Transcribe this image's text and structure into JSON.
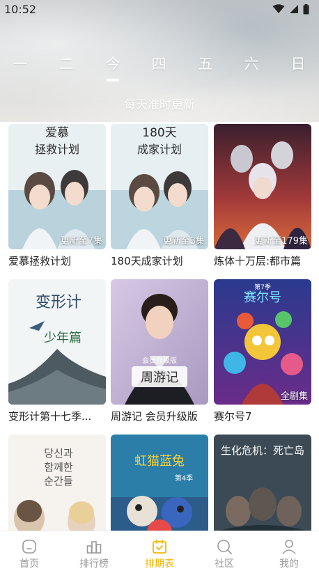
{
  "status_bar": {
    "time": "10:52"
  },
  "day_tabs": [
    "一",
    "二",
    "今",
    "四",
    "五",
    "六",
    "日"
  ],
  "selected_day_index": 2,
  "subtitle": "每天准时更新",
  "cards": [
    {
      "title": "爱慕拯救计划",
      "badge": "更新至7集",
      "cover_text": [
        "爱慕",
        "拯救计划"
      ]
    },
    {
      "title": "180天成家计划",
      "badge": "更新至3集",
      "cover_text": [
        "180天",
        "成家计划"
      ]
    },
    {
      "title": "炼体十万层:都市篇",
      "badge": "更新至179集",
      "cover_text": []
    },
    {
      "title": "变形计第十七季...",
      "badge": "",
      "cover_text": [
        "变形计",
        "少年篇"
      ]
    },
    {
      "title": "周游记 会员升级版",
      "badge": "",
      "cover_text": [
        "会员升级版",
        "周游记"
      ]
    },
    {
      "title": "赛尔号7",
      "badge": "全剧集",
      "cover_text": [
        "赛尔号",
        "第7季"
      ]
    },
    {
      "title": "",
      "badge": "",
      "cover_text": [
        "당신과",
        "함께한",
        "순간들"
      ]
    },
    {
      "title": "",
      "badge": "",
      "cover_text": [
        "虹猫蓝兔",
        "第4季"
      ]
    },
    {
      "title": "",
      "badge": "",
      "cover_text": [
        "生化危机：死亡岛"
      ]
    }
  ],
  "bottom_nav": [
    {
      "label": "首页",
      "icon": "home-icon"
    },
    {
      "label": "排行榜",
      "icon": "ranking-icon"
    },
    {
      "label": "排期表",
      "icon": "calendar-icon"
    },
    {
      "label": "社区",
      "icon": "community-icon"
    },
    {
      "label": "我的",
      "icon": "profile-icon"
    }
  ],
  "active_nav_index": 2,
  "colors": {
    "accent": "#f5b400",
    "nav_inactive": "#9a9a9a",
    "text": "#222222"
  }
}
